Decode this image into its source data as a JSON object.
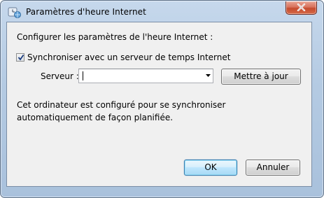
{
  "window": {
    "title": "Paramètres d'heure Internet",
    "icon": "clock-globe-icon",
    "close_icon": "close-icon"
  },
  "content": {
    "configure_label": "Configurer les paramètres de l'heure Internet :",
    "sync_checkbox": {
      "label": "Synchroniser avec un serveur de temps Internet",
      "checked": true
    },
    "server": {
      "label": "Serveur :",
      "value": "",
      "dropdown_icon": "chevron-down-icon"
    },
    "update_button_label": "Mettre à jour",
    "info_text": "Cet ordinateur est configuré pour se synchroniser automatiquement de façon planifiée."
  },
  "footer": {
    "ok_label": "OK",
    "cancel_label": "Annuler"
  },
  "colors": {
    "close_button": "#c44b2e",
    "default_button_border": "#3c7fb1",
    "client_bg": "#f0f0f0"
  }
}
